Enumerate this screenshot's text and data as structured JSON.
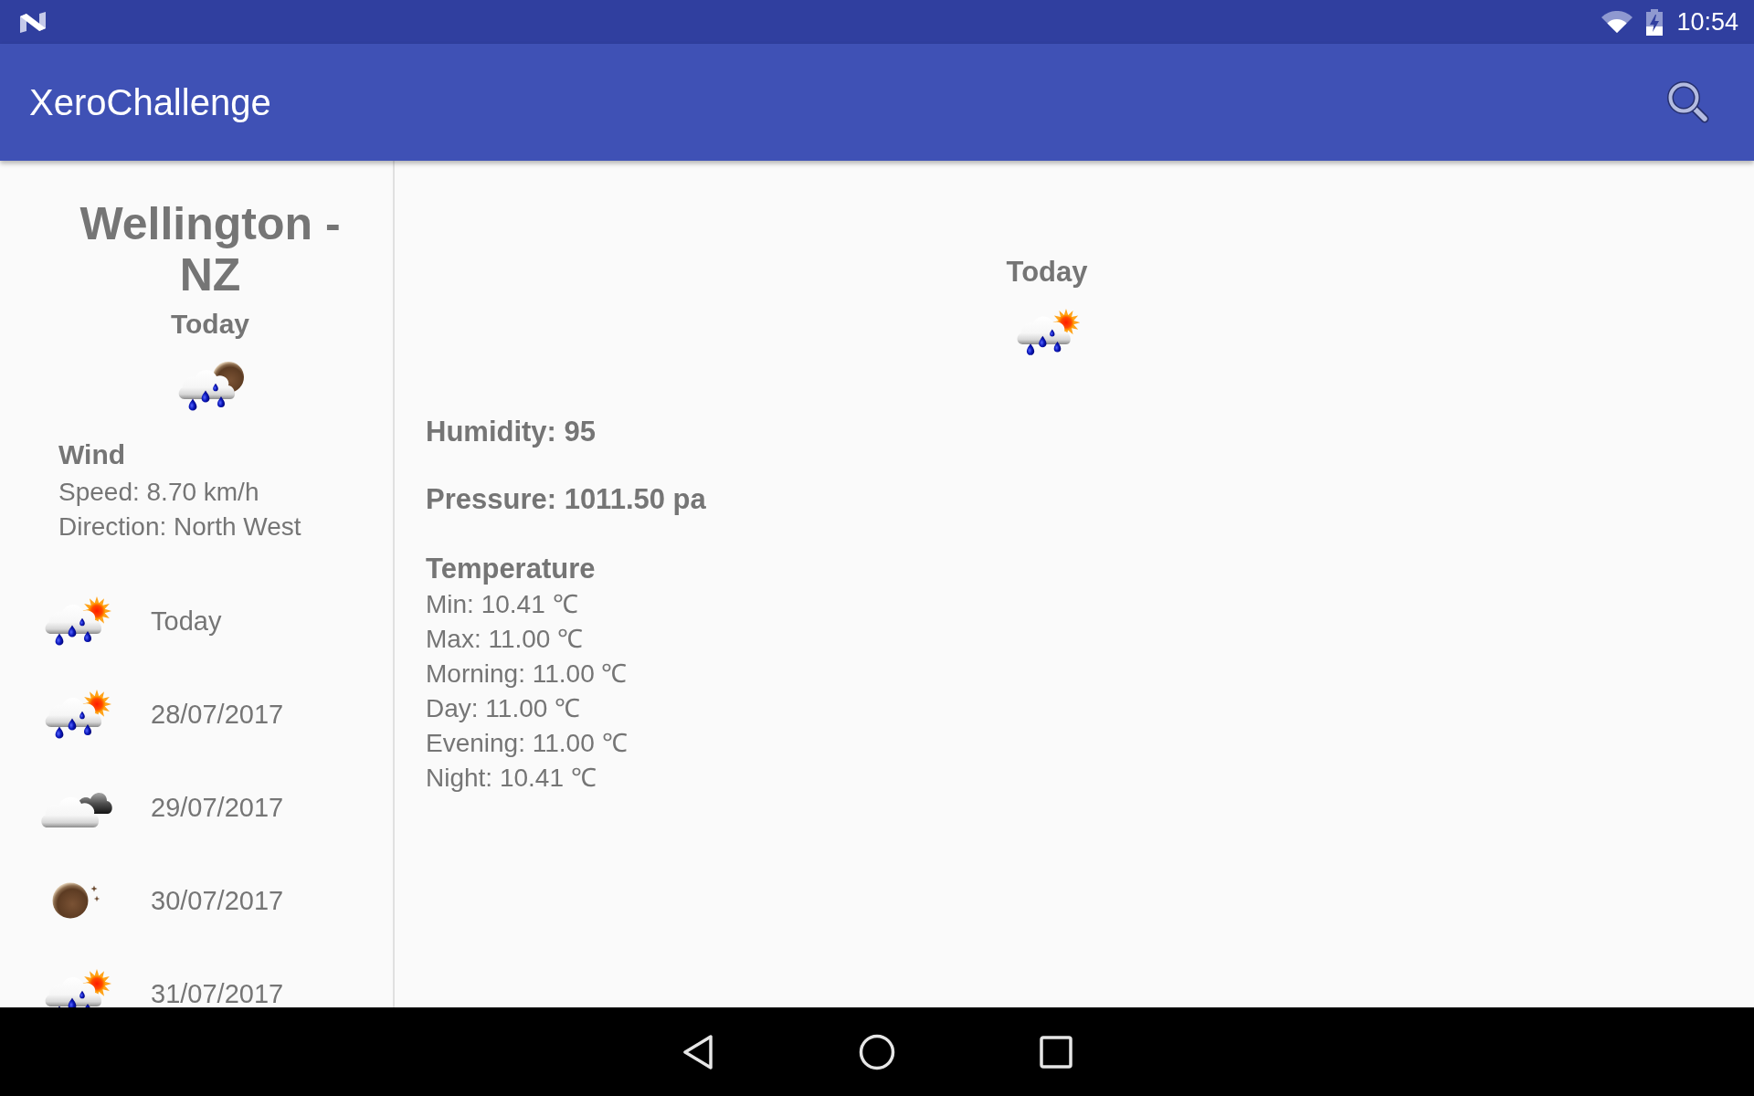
{
  "status_bar": {
    "time": "10:54"
  },
  "app_bar": {
    "title": "XeroChallenge"
  },
  "sidebar": {
    "city": "Wellington - NZ",
    "day": "Today",
    "kind": "nightrain",
    "wind": {
      "title": "Wind",
      "speed": "Speed: 8.70 km/h",
      "direction": "Direction: North West"
    },
    "forecast": [
      {
        "label": "Today",
        "kind": "rain"
      },
      {
        "label": "28/07/2017",
        "kind": "rain"
      },
      {
        "label": "29/07/2017",
        "kind": "cloudy"
      },
      {
        "label": "30/07/2017",
        "kind": "night"
      },
      {
        "label": "31/07/2017",
        "kind": "rain"
      }
    ]
  },
  "detail": {
    "day": "Today",
    "kind": "rain",
    "humidity": "Humidity: 95",
    "pressure": "Pressure: 1011.50 pa",
    "temperature": {
      "title": "Temperature",
      "lines": [
        "Min: 10.41 ℃",
        "Max: 11.00 ℃",
        "Morning: 11.00 ℃",
        "Day: 11.00 ℃",
        "Evening: 11.00 ℃",
        "Night: 10.41 ℃"
      ]
    }
  }
}
